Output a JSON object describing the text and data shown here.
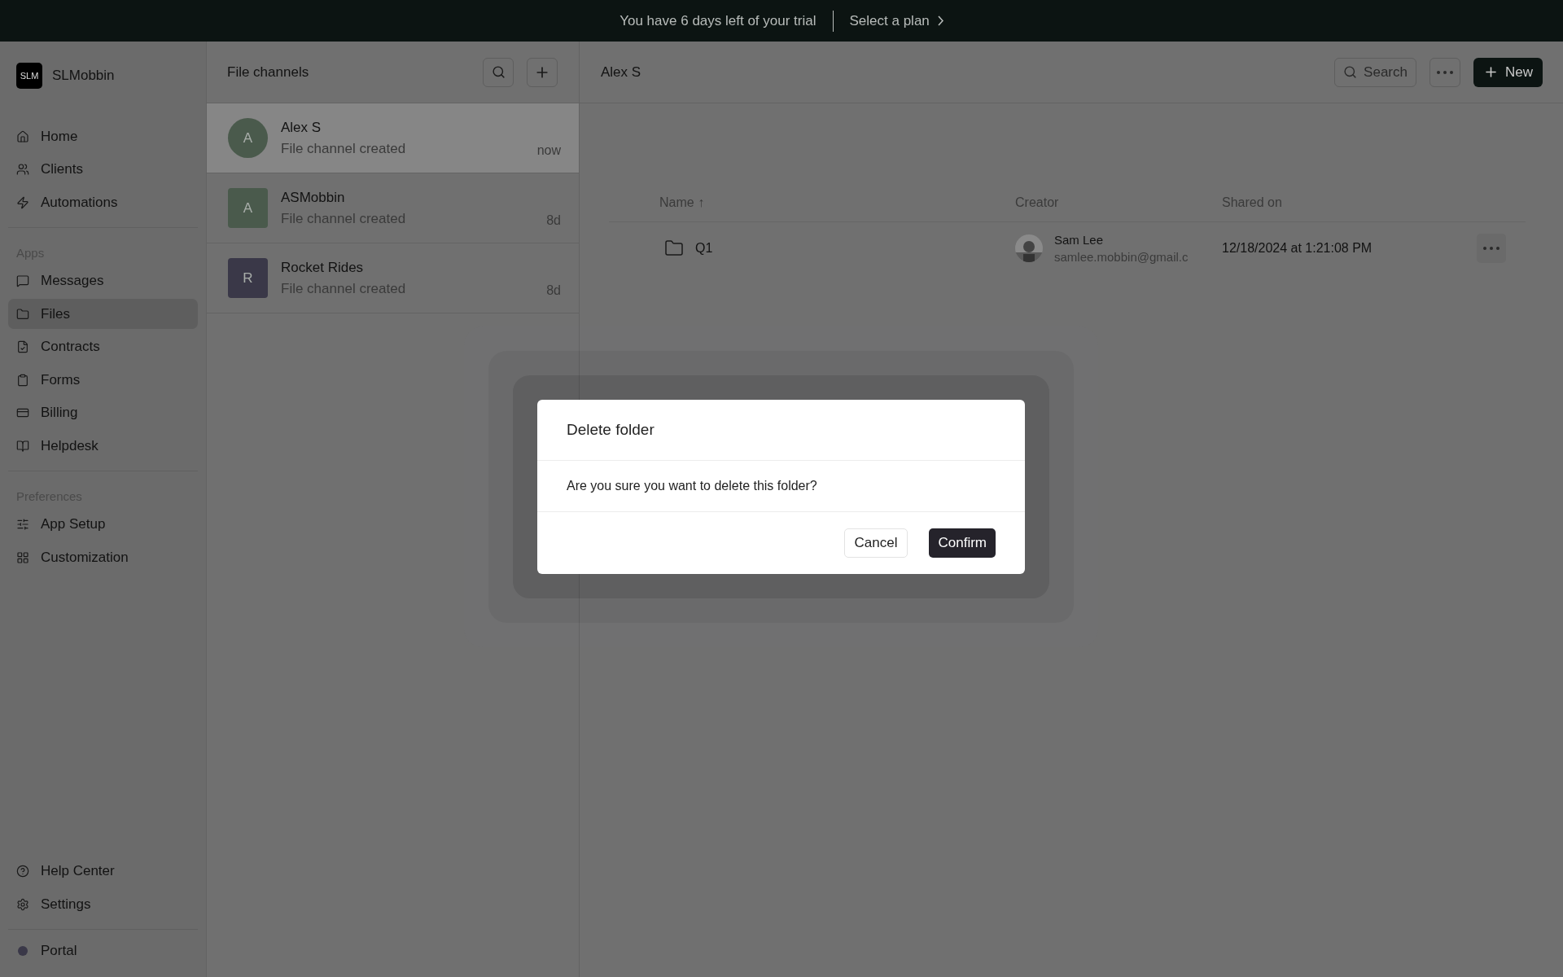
{
  "banner": {
    "text": "You have 6 days left of your trial",
    "link": "Select a plan"
  },
  "sidebar": {
    "brand": {
      "logo": "SLM",
      "name": "SLMobbin"
    },
    "groups": [
      {
        "items": [
          {
            "label": "Home",
            "selected": false
          },
          {
            "label": "Clients",
            "selected": false
          },
          {
            "label": "Automations",
            "selected": false
          }
        ]
      },
      {
        "heading": "Apps",
        "items": [
          {
            "label": "Messages",
            "selected": false
          },
          {
            "label": "Files",
            "selected": true
          },
          {
            "label": "Contracts",
            "selected": false
          },
          {
            "label": "Forms",
            "selected": false
          },
          {
            "label": "Billing",
            "selected": false
          },
          {
            "label": "Helpdesk",
            "selected": false
          }
        ]
      },
      {
        "heading": "Preferences",
        "items": [
          {
            "label": "App Setup",
            "selected": false
          },
          {
            "label": "Customization",
            "selected": false
          }
        ]
      }
    ],
    "footer": [
      {
        "label": "Help Center"
      },
      {
        "label": "Settings"
      }
    ],
    "portal": {
      "label": "Portal",
      "color": "#3a3848"
    }
  },
  "channels": {
    "title": "File channels",
    "items": [
      {
        "initial": "A",
        "name": "Alex S",
        "subtitle": "File channel created",
        "time": "now",
        "kind": "person",
        "color": "#4a5a4c",
        "selected": true
      },
      {
        "initial": "A",
        "name": "ASMobbin",
        "subtitle": "File channel created",
        "time": "8d",
        "kind": "company",
        "color": "#4a5a4c",
        "selected": false
      },
      {
        "initial": "R",
        "name": "Rocket Rides",
        "subtitle": "File channel created",
        "time": "8d",
        "kind": "company",
        "color": "#3a3848",
        "selected": false
      }
    ]
  },
  "main": {
    "title": "Alex S",
    "search": "Search",
    "new": "New",
    "table": {
      "columns": [
        "Name ↑",
        "Creator",
        "Shared on"
      ],
      "rows": [
        {
          "name": "Q1",
          "creator": "Sam Lee",
          "email": "samlee.mobbin@gmail.c",
          "shared": "12/18/2024 at 1:21:08 PM"
        }
      ]
    }
  },
  "dialog": {
    "title": "Delete folder",
    "message": "Are you sure you want to delete this folder?",
    "cancel": "Cancel",
    "confirm": "Confirm"
  }
}
